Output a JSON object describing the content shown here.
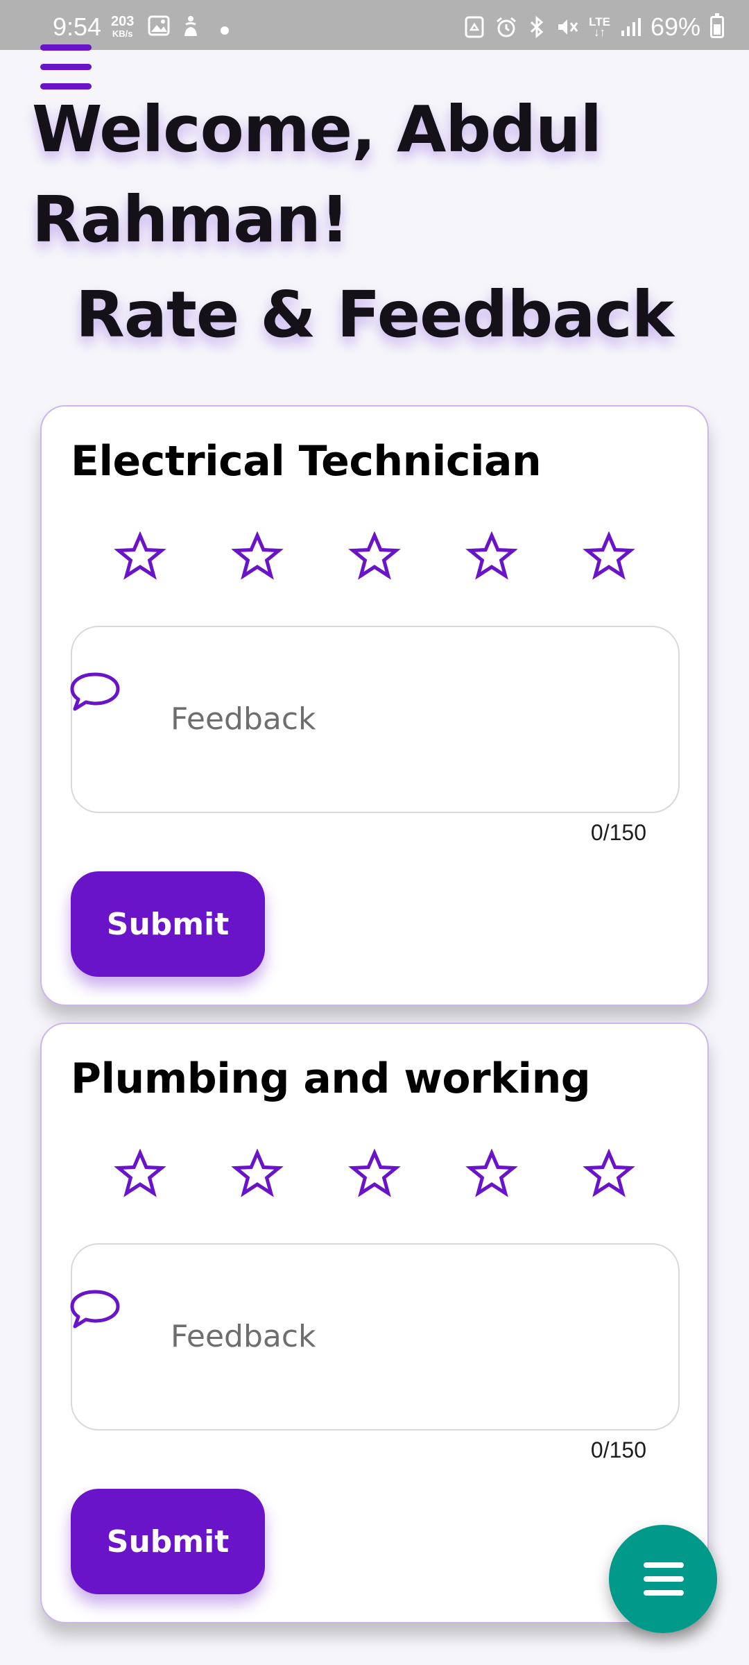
{
  "status_bar": {
    "time": "9:54",
    "net_speed": "203",
    "net_unit": "KB/s",
    "network": "LTE",
    "battery": "69%",
    "battery_level": 0.69,
    "icons": [
      "image-icon",
      "accessibility-icon",
      "notification-dot-icon",
      "recycle-icon",
      "alarm-icon",
      "bluetooth-icon",
      "mute-icon",
      "lte-icon",
      "signal-icon",
      "battery-icon"
    ]
  },
  "header": {
    "menu_icon": "hamburger-menu-icon",
    "welcome": "Welcome, Abdul Rahman!",
    "section_title": "Rate & Feedback"
  },
  "cards": [
    {
      "title": "Electrical Technician",
      "rating": 0,
      "max_rating": 5,
      "feedback_placeholder": "Feedback",
      "feedback_value": "",
      "counter": "0/150",
      "submit_label": "Submit"
    },
    {
      "title": "Plumbing and working",
      "rating": 0,
      "max_rating": 5,
      "feedback_placeholder": "Feedback",
      "feedback_value": "",
      "counter": "0/150",
      "submit_label": "Submit"
    }
  ],
  "fab": {
    "icon": "hamburger-menu-icon"
  },
  "colors": {
    "accent": "#6a14c9",
    "fab": "#00998a",
    "background": "#f6f6fa",
    "status_bar": "#b2b2b2",
    "card_border": "#cdb5ee"
  }
}
